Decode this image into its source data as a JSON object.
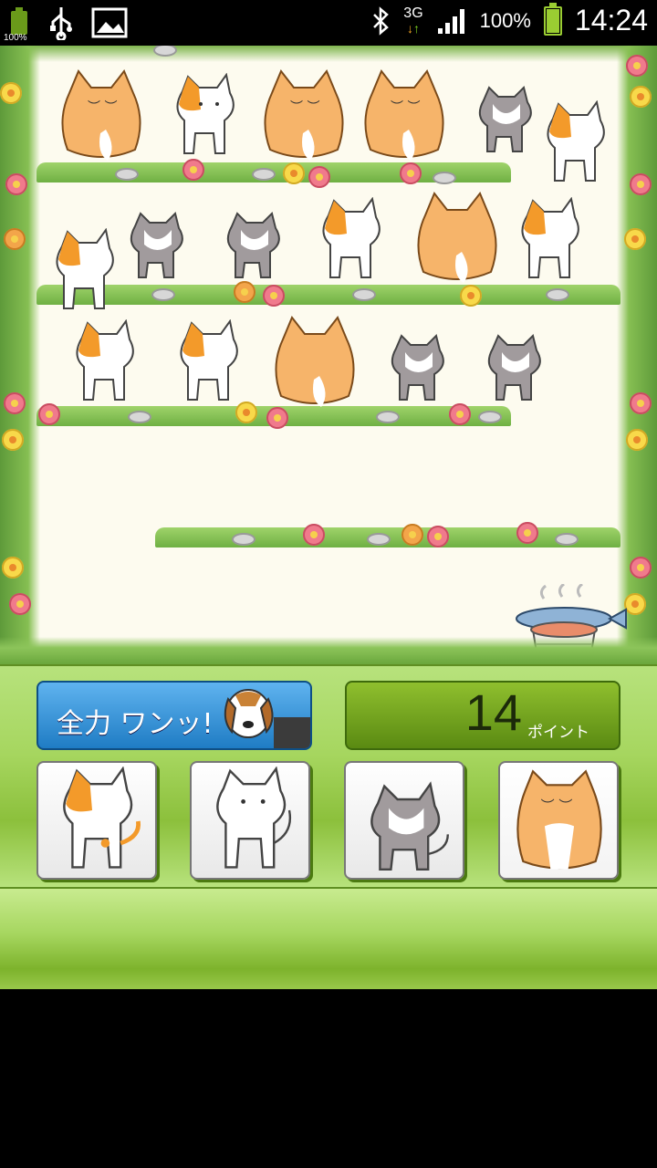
{
  "status_bar": {
    "battery_small_label": "100%",
    "network_label": "3G",
    "battery_percent": "100%",
    "time": "14:24"
  },
  "game": {
    "power_button_label": "全力 ワンッ!",
    "points_value": "14",
    "points_unit": "ポイント",
    "cat_buttons": [
      "calico-cat",
      "white-cat",
      "gray-tabby-cat",
      "orange-fat-cat"
    ]
  },
  "colors": {
    "field_bg": "#fdfbef",
    "orange_cat": "#f6b46a",
    "calico_patch": "#f39a2a",
    "gray_cat": "#9a9496",
    "panel_green": "#a6d65f",
    "power_blue": "#2a8ad2"
  }
}
